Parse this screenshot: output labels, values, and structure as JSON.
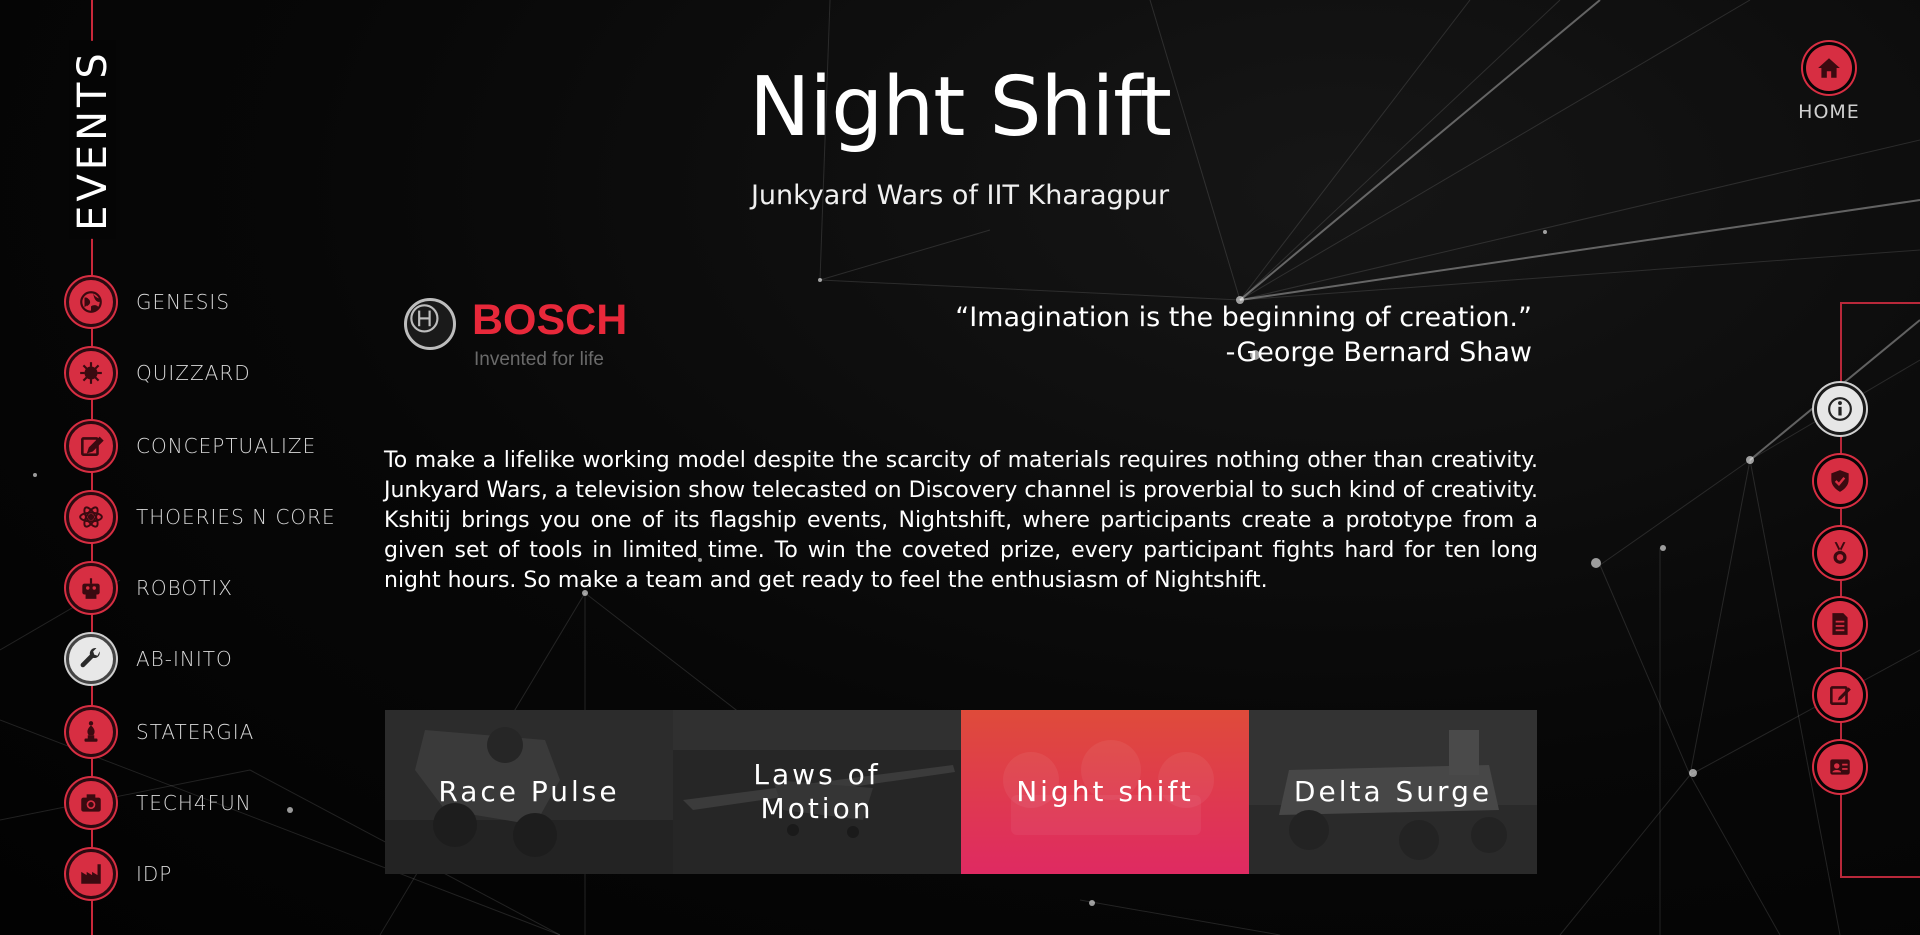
{
  "sidebar": {
    "title": "EVENTS",
    "items": [
      {
        "label": "GENESIS",
        "icon": "globe-icon"
      },
      {
        "label": "QUIZZARD",
        "icon": "virus-icon"
      },
      {
        "label": "CONCEPTUALIZE",
        "icon": "edit-icon"
      },
      {
        "label": "THOERIES N CORE",
        "icon": "atom-icon"
      },
      {
        "label": "ROBOTIX",
        "icon": "robot-icon"
      },
      {
        "label": "AB-INITO",
        "icon": "wrench-icon",
        "active": true
      },
      {
        "label": "STATERGIA",
        "icon": "chess-bishop-icon"
      },
      {
        "label": "TECH4FUN",
        "icon": "camera-icon"
      },
      {
        "label": "IDP",
        "icon": "factory-icon"
      }
    ]
  },
  "header": {
    "title": "Night Shift",
    "subtitle": "Junkyard Wars of IIT Kharagpur"
  },
  "home": {
    "label": "HOME",
    "icon": "home-icon"
  },
  "sponsor": {
    "name": "BOSCH",
    "tagline": "Invented for life"
  },
  "quote": {
    "text": "“Imagination is the beginning of creation.”",
    "author": "-George Bernard Shaw"
  },
  "description": " To make a lifelike working model despite the scarcity of materials requires nothing other than creativity. Junkyard Wars, a television show telecasted on Discovery channel is proverbial to such kind of creativity. Kshitij brings you one of its flagship events, Nightshift, where participants create a prototype from a given set of tools in limited time. To win the coveted prize, every participant fights hard for ten long night hours. So make a team and get ready to feel the enthusiasm of Nightshift.",
  "cards": [
    {
      "label": "Race Pulse"
    },
    {
      "label": "Laws of Motion"
    },
    {
      "label": "Night shift",
      "active": true
    },
    {
      "label": "Delta Surge"
    }
  ],
  "right_nav": [
    {
      "icon": "info-icon",
      "active": true
    },
    {
      "icon": "shield-check-icon"
    },
    {
      "icon": "medal-icon"
    },
    {
      "icon": "document-icon"
    },
    {
      "icon": "edit-icon"
    },
    {
      "icon": "contact-card-icon"
    }
  ],
  "colors": {
    "accent": "#d72e42",
    "card_active_top": "#e04a3a",
    "card_active_bottom": "#e0285e"
  }
}
